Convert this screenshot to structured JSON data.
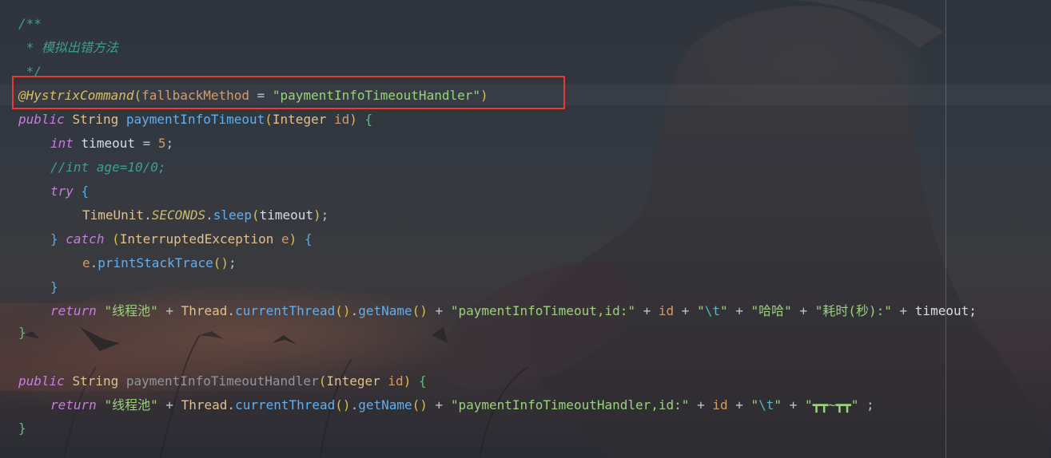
{
  "colors": {
    "highlight_border": "#e53a35",
    "doc_comment": "#3f9f8f",
    "annotation": "#d9bd62",
    "string": "#9ad27c",
    "keyword": "#c57fdc",
    "method": "#61afef"
  },
  "editor": {
    "doc": {
      "open": "/**",
      "line": " * 模拟出错方法",
      "close": " */"
    },
    "annotation": {
      "name": "@HystrixCommand",
      "open": "(",
      "param": "fallbackMethod",
      "eq": " = ",
      "value": "\"paymentInfoTimeoutHandler\"",
      "close": ")"
    },
    "method1": {
      "kw_public": "public",
      "type_string": "String",
      "name": "paymentInfoTimeout",
      "open": "(",
      "param_type": "Integer",
      "param_name": "id",
      "close": ")",
      "brace": "{"
    },
    "line_int": {
      "kw": "int",
      "var": "timeout",
      "eq": " = ",
      "num": "5",
      "semi": ";"
    },
    "line_comment": "//int age=10/0;",
    "line_try": {
      "kw": "try",
      "brace": "{"
    },
    "line_sleep": {
      "cls": "TimeUnit",
      "dot1": ".",
      "field": "SECONDS",
      "dot2": ".",
      "method": "sleep",
      "open": "(",
      "arg": "timeout",
      "close": ")",
      "semi": ";"
    },
    "line_catch": {
      "close": "}",
      "kw": "catch",
      "open": "(",
      "exc": "InterruptedException",
      "var": "e",
      "close_paren": ")",
      "brace": "{"
    },
    "line_print": {
      "var": "e",
      "dot": ".",
      "method": "printStackTrace",
      "parens": "()",
      "semi": ";"
    },
    "line_close_try": "}",
    "line_return1": {
      "kw": "return",
      "s1": "\"线程池\"",
      "plus": " + ",
      "cls": "Thread",
      "dot1": ".",
      "m1": "currentThread",
      "p1": "()",
      "dot2": ".",
      "m2": "getName",
      "p2": "()",
      "s2": "\"paymentInfoTimeout,id:\"",
      "id": "id",
      "s3_open": "\"",
      "s3_esc": "\\t",
      "s3_close": "\"",
      "s4": "\"哈哈\"",
      "s5": "\"耗时(秒):\"",
      "tail": "timeout;"
    },
    "method1_close": "}",
    "method2": {
      "kw_public": "public",
      "type_string": "String",
      "name": "paymentInfoTimeoutHandler",
      "open": "(",
      "param_type": "Integer",
      "param_name": "id",
      "close": ")",
      "brace": "{"
    },
    "line_return2": {
      "kw": "return",
      "s1": "\"线程池\"",
      "plus": " + ",
      "cls": "Thread",
      "dot1": ".",
      "m1": "currentThread",
      "p1": "()",
      "dot2": ".",
      "m2": "getName",
      "p2": "()",
      "s2": "\"paymentInfoTimeoutHandler,id:\"",
      "id": "id",
      "s3_open": "\"",
      "s3_esc": "\\t",
      "s3_close": "\"",
      "s4": "\"┳┳~┳┳\"",
      "tail": " ;"
    },
    "method2_close": "}"
  }
}
